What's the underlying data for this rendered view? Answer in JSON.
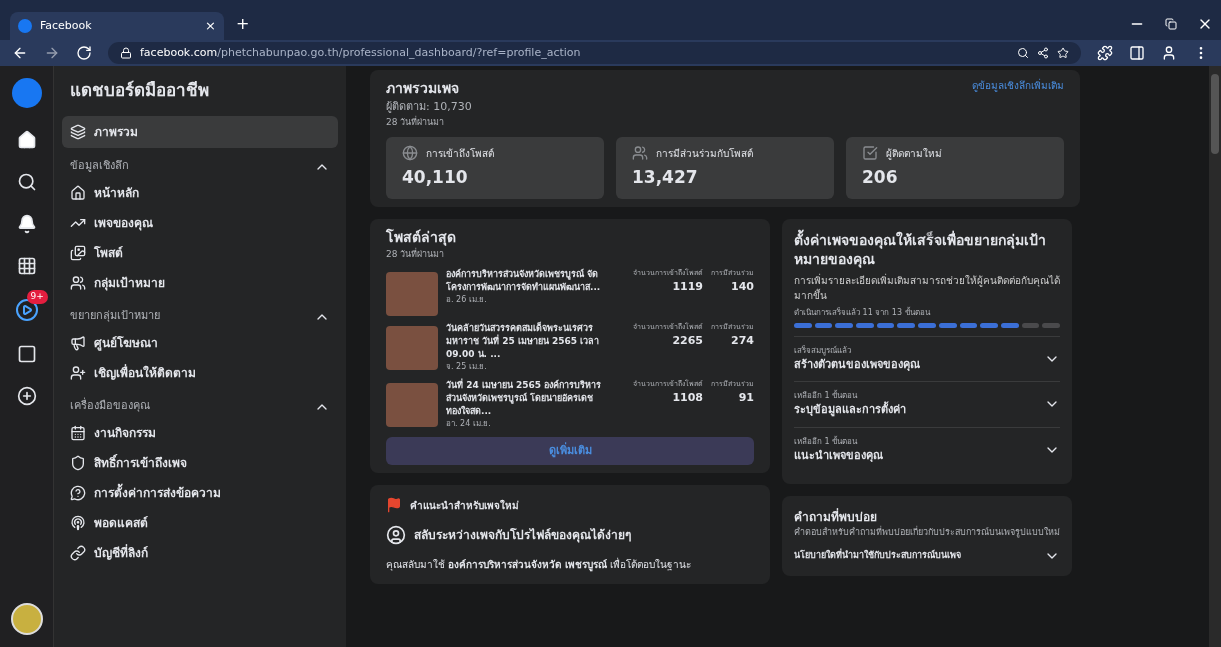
{
  "browser": {
    "tab": {
      "title": "Facebook",
      "close": "×"
    },
    "new_tab": "+",
    "url_host": "facebook.com",
    "url_path": "/phetchabunpao.go.th/professional_dashboard/?ref=profile_action"
  },
  "rail": {
    "badge": "9+"
  },
  "sidebar": {
    "title": "แดชบอร์ดมืออาชีพ",
    "overview": {
      "label": "ภาพรวม",
      "selected": true
    },
    "sections": [
      {
        "title": "ข้อมูลเชิงลึก",
        "expanded": true,
        "items": [
          {
            "label": "หน้าหลัก",
            "selected": false
          },
          {
            "label": "เพจของคุณ",
            "selected": false
          },
          {
            "label": "โพสต์",
            "selected": false
          },
          {
            "label": "กลุ่มเป้าหมาย",
            "selected": false
          }
        ]
      },
      {
        "title": "ขยายกลุ่มเป้าหมาย",
        "expanded": true,
        "items": [
          {
            "label": "ศูนย์โฆษณา",
            "selected": false
          },
          {
            "label": "เชิญเพื่อนให้ติดตาม",
            "selected": false
          }
        ]
      },
      {
        "title": "เครื่องมือของคุณ",
        "expanded": true,
        "items": [
          {
            "label": "งานกิจกรรม",
            "selected": false
          },
          {
            "label": "สิทธิ์การเข้าถึงเพจ",
            "selected": false
          },
          {
            "label": "การตั้งค่าการส่งข้อความ",
            "selected": false
          },
          {
            "label": "พอดแคสต์",
            "selected": false
          },
          {
            "label": "บัญชีที่ลิงก์",
            "selected": false
          }
        ]
      }
    ]
  },
  "overview": {
    "title": "ภาพรวมเพจ",
    "followers": "ผู้ติดตาม: 10,730",
    "period": "28 วันที่ผ่านมา",
    "more_link": "ดูข้อมูลเชิงลึกเพิ่มเติม",
    "stats": [
      {
        "label": "การเข้าถึงโพสต์",
        "value": "40,110"
      },
      {
        "label": "การมีส่วนร่วมกับโพสต์",
        "value": "13,427"
      },
      {
        "label": "ผู้ติดตามใหม่",
        "value": "206"
      }
    ]
  },
  "latest_posts": {
    "title": "โพสต์ล่าสุด",
    "period": "28 วันที่ผ่านมา",
    "posts": [
      {
        "text": "องค์การบริหารส่วนจังหวัดเพชรบูรณ์ จัดโครงการพัฒนาการจัดทำแผนพัฒนาส...",
        "date": "อ. 26 เม.ย.",
        "reach_label": "จำนวนการเข้าถึงโพสต์",
        "reach": "1119",
        "engagement_label": "การมีส่วนร่วม",
        "engagement": "140"
      },
      {
        "text": "วันคล้ายวันสวรรคตสมเด็จพระนเรศวรมหาราช วันที่ 25 เมษายน 2565 เวลา 09.00 น. ...",
        "date": "จ. 25 เม.ย.",
        "reach_label": "จำนวนการเข้าถึงโพสต์",
        "reach": "2265",
        "engagement_label": "การมีส่วนร่วม",
        "engagement": "274"
      },
      {
        "text": "วันที่ 24 เมษายน 2565 องค์การบริหารส่วนจังหวัดเพชรบูรณ์ โดยนายอัครเดช ทองใจสด...",
        "date": "อา. 24 เม.ย.",
        "reach_label": "จำนวนการเข้าถึงโพสต์",
        "reach": "1108",
        "engagement_label": "การมีส่วนร่วม",
        "engagement": "91"
      }
    ],
    "more_button": "ดูเพิ่มเติม"
  },
  "setup": {
    "title": "ตั้งค่าเพจของคุณให้เสร็จเพื่อขยายกลุ่มเป้าหมายของคุณ",
    "subtitle": "การเพิ่มรายละเอียดเพิ่มเติมสามารถช่วยให้ผู้คนติดต่อกับคุณได้มากขึ้น",
    "progress_text": "ดำเนินการเสร็จแล้ว 11 จาก 13 ขั้นตอน",
    "level": 0.846,
    "steps": [
      {
        "status": "เสร็จสมบูรณ์แล้ว",
        "title": "สร้างตัวตนของเพจของคุณ",
        "expanded": false
      },
      {
        "status": "เหลืออีก 1 ขั้นตอน",
        "title": "ระบุข้อมูลและการตั้งค่า",
        "expanded": false
      },
      {
        "status": "เหลืออีก 1 ขั้นตอน",
        "title": "แนะนำเพจของคุณ",
        "expanded": false
      }
    ]
  },
  "tips": {
    "title": "คำแนะนำสำหรับเพจใหม่",
    "heading": "สลับระหว่างเพจกับโปรไฟล์ของคุณได้ง่ายๆ",
    "body": "คุณสลับมาใช้ **องค์การบริหารส่วนจังหวัด เพชรบูรณ์** เพื่อโต้ตอบในฐานะ"
  },
  "faq": {
    "title": "คำถามที่พบบ่อย",
    "subtitle": "คำตอบสำหรับคำถามที่พบบ่อยเกี่ยวกับประสบการณ์บนเพจรูปแบบใหม่",
    "items": [
      {
        "question": "นโยบายใดที่นำมาใช้กับประสบการณ์บนเพจ",
        "expanded": false
      }
    ]
  }
}
